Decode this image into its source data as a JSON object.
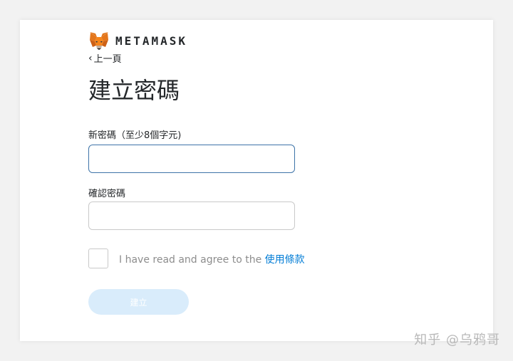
{
  "brand": {
    "wordmark": "METAMASK",
    "logo_icon": "fox-icon"
  },
  "nav": {
    "back_label": "上一頁",
    "back_icon": "chevron-left-icon"
  },
  "page": {
    "title": "建立密碼"
  },
  "form": {
    "new_password": {
      "label": "新密碼（至少8個字元)",
      "value": ""
    },
    "confirm_password": {
      "label": "確認密碼",
      "value": ""
    },
    "terms": {
      "checked": false,
      "text": "I have read and agree to the ",
      "link_text": "使用條款"
    },
    "submit": {
      "label": "建立",
      "enabled": false
    }
  },
  "watermark": {
    "text": "知乎 @乌鸦哥"
  },
  "colors": {
    "link": "#037dd6",
    "focus_border": "#3d73a8",
    "disabled_button": "#d9ecfb"
  }
}
